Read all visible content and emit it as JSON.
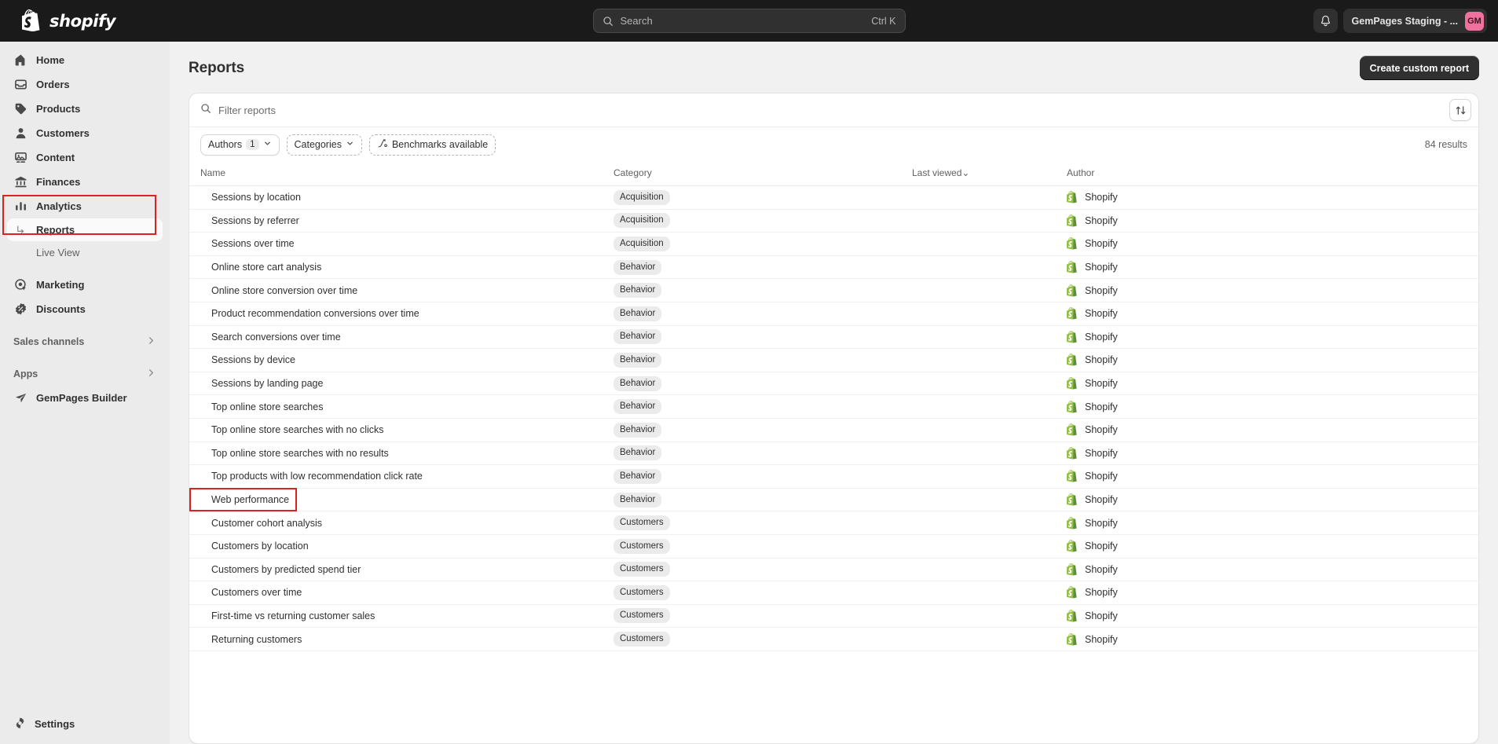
{
  "topbar": {
    "brand": "shopify",
    "search": {
      "placeholder": "Search",
      "shortcut": "Ctrl K",
      "icon": "search-icon"
    },
    "notifications_icon": "bell-icon",
    "store_name": "GemPages Staging - ...",
    "avatar_initials": "GM",
    "avatar_color": "#f0709e",
    "background": "#1a1a1a"
  },
  "sidebar": {
    "items": [
      {
        "label": "Home",
        "icon": "home-icon"
      },
      {
        "label": "Orders",
        "icon": "orders-icon"
      },
      {
        "label": "Products",
        "icon": "tag-icon"
      },
      {
        "label": "Customers",
        "icon": "person-icon"
      },
      {
        "label": "Content",
        "icon": "content-icon"
      },
      {
        "label": "Finances",
        "icon": "bank-icon"
      },
      {
        "label": "Analytics",
        "icon": "bar-chart-icon"
      }
    ],
    "analytics_children": [
      {
        "label": "Reports",
        "selected": true,
        "icon": "arrow-subnav-icon"
      },
      {
        "label": "Live View",
        "selected": false
      }
    ],
    "items_after": [
      {
        "label": "Marketing",
        "icon": "marketing-target-icon"
      },
      {
        "label": "Discounts",
        "icon": "discount-icon"
      }
    ],
    "sections": [
      {
        "label": "Sales channels",
        "icon": "chevron-right-icon"
      },
      {
        "label": "Apps",
        "icon": "chevron-right-icon"
      }
    ],
    "apps": [
      {
        "label": "GemPages Builder",
        "icon": "gempages-icon"
      }
    ],
    "settings": {
      "label": "Settings",
      "icon": "gear-icon"
    },
    "highlight_color": "#e02020"
  },
  "page": {
    "title": "Reports",
    "create_button": "Create custom report"
  },
  "filters": {
    "search_placeholder": "Filter reports",
    "search_icon": "search-icon",
    "sort_icon": "sort-arrows-icon",
    "pills": [
      {
        "label": "Authors",
        "count": "1",
        "style": "solid",
        "caret": true
      },
      {
        "label": "Categories",
        "count": null,
        "style": "dashed",
        "caret": true
      },
      {
        "label": "Benchmarks available",
        "count": null,
        "style": "dashed",
        "caret": false,
        "icon": "benchmark-icon"
      }
    ],
    "results": "84 results"
  },
  "table": {
    "columns": [
      "Name",
      "Category",
      "Last viewed",
      "Author"
    ],
    "sorted_column": "Last viewed",
    "sort_caret": "⌄",
    "author_icon": "shopify-bag-icon",
    "rows": [
      {
        "name": "Sessions by location",
        "category": "Acquisition",
        "last_viewed": "",
        "author": "Shopify"
      },
      {
        "name": "Sessions by referrer",
        "category": "Acquisition",
        "last_viewed": "",
        "author": "Shopify"
      },
      {
        "name": "Sessions over time",
        "category": "Acquisition",
        "last_viewed": "",
        "author": "Shopify"
      },
      {
        "name": "Online store cart analysis",
        "category": "Behavior",
        "last_viewed": "",
        "author": "Shopify"
      },
      {
        "name": "Online store conversion over time",
        "category": "Behavior",
        "last_viewed": "",
        "author": "Shopify"
      },
      {
        "name": "Product recommendation conversions over time",
        "category": "Behavior",
        "last_viewed": "",
        "author": "Shopify"
      },
      {
        "name": "Search conversions over time",
        "category": "Behavior",
        "last_viewed": "",
        "author": "Shopify"
      },
      {
        "name": "Sessions by device",
        "category": "Behavior",
        "last_viewed": "",
        "author": "Shopify"
      },
      {
        "name": "Sessions by landing page",
        "category": "Behavior",
        "last_viewed": "",
        "author": "Shopify"
      },
      {
        "name": "Top online store searches",
        "category": "Behavior",
        "last_viewed": "",
        "author": "Shopify"
      },
      {
        "name": "Top online store searches with no clicks",
        "category": "Behavior",
        "last_viewed": "",
        "author": "Shopify"
      },
      {
        "name": "Top online store searches with no results",
        "category": "Behavior",
        "last_viewed": "",
        "author": "Shopify"
      },
      {
        "name": "Top products with low recommendation click rate",
        "category": "Behavior",
        "last_viewed": "",
        "author": "Shopify"
      },
      {
        "name": "Web performance",
        "category": "Behavior",
        "last_viewed": "",
        "author": "Shopify",
        "highlighted": true
      },
      {
        "name": "Customer cohort analysis",
        "category": "Customers",
        "last_viewed": "",
        "author": "Shopify"
      },
      {
        "name": "Customers by location",
        "category": "Customers",
        "last_viewed": "",
        "author": "Shopify"
      },
      {
        "name": "Customers by predicted spend tier",
        "category": "Customers",
        "last_viewed": "",
        "author": "Shopify"
      },
      {
        "name": "Customers over time",
        "category": "Customers",
        "last_viewed": "",
        "author": "Shopify"
      },
      {
        "name": "First-time vs returning customer sales",
        "category": "Customers",
        "last_viewed": "",
        "author": "Shopify"
      },
      {
        "name": "Returning customers",
        "category": "Customers",
        "last_viewed": "",
        "author": "Shopify"
      }
    ]
  }
}
